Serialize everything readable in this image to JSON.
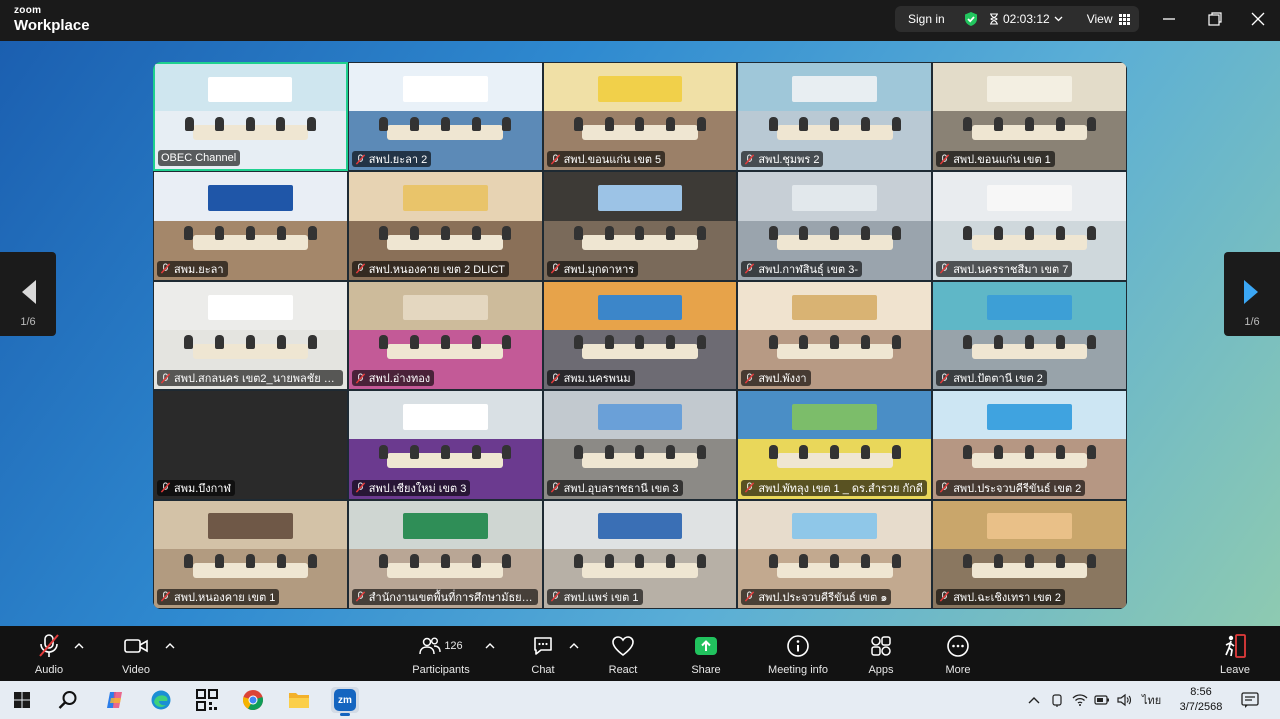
{
  "titlebar": {
    "logo_top": "zoom",
    "logo_bottom": "Workplace",
    "sign_in": "Sign in",
    "timer": "02:03:12",
    "view": "View"
  },
  "pager": {
    "left_page": "1/6",
    "right_page": "1/6"
  },
  "tiles": [
    {
      "name": "OBEC Channel",
      "muted": false,
      "wall": "#cfe6ef",
      "floor": "#e7eef4",
      "banner": "#ffffff"
    },
    {
      "name": "สพป.ยะลา 2",
      "muted": true,
      "wall": "#e9f1f8",
      "floor": "#5c8ab7",
      "banner": "#ffffff"
    },
    {
      "name": "สพป.ขอนแก่น เขต 5",
      "muted": true,
      "wall": "#f0e0a6",
      "floor": "#9b8068",
      "banner": "#f1d04a"
    },
    {
      "name": "สพป.ชุมพร 2",
      "muted": true,
      "wall": "#9fc7d9",
      "floor": "#b9c9d4",
      "banner": "#e8eef2"
    },
    {
      "name": "สพป.ขอนแก่น เขต 1",
      "muted": true,
      "wall": "#e3dcc9",
      "floor": "#8a8275",
      "banner": "#f3efe2"
    },
    {
      "name": "สพม.ยะลา",
      "muted": true,
      "wall": "#e9eef5",
      "floor": "#a4876a",
      "banner": "#1f56a8"
    },
    {
      "name": "สพป.หนองคาย เขต 2 DLICT",
      "muted": true,
      "wall": "#e7d3b3",
      "floor": "#8a7058",
      "banner": "#e9c46a"
    },
    {
      "name": "สพป.มุกดาหาร",
      "muted": true,
      "wall": "#3d3a36",
      "floor": "#7a6a5a",
      "banner": "#9cc3e6"
    },
    {
      "name": "สพป.กาฬสินธุ์ เขต 3-",
      "muted": true,
      "wall": "#c7cfd6",
      "floor": "#9aa4ad",
      "banner": "#e2e8ec"
    },
    {
      "name": "สพป.นครราชสีมา เขต 7",
      "muted": true,
      "wall": "#e9ecef",
      "floor": "#cfd8dc",
      "banner": "#f7f7f7"
    },
    {
      "name": "สพป.สกลนคร เขต2_นายพลชัย ชุม...",
      "muted": true,
      "wall": "#ececea",
      "floor": "#e4e4e0",
      "banner": "#ffffff"
    },
    {
      "name": "สพป.อ่างทอง",
      "muted": true,
      "wall": "#cdbb9b",
      "floor": "#c35a97",
      "banner": "#e4d7c0"
    },
    {
      "name": "สพม.นครพนม",
      "muted": true,
      "wall": "#e7a34a",
      "floor": "#6d6b73",
      "banner": "#3c86c9"
    },
    {
      "name": "สพป.พังงา",
      "muted": true,
      "wall": "#f0e3cf",
      "floor": "#b79a84",
      "banner": "#d9b373"
    },
    {
      "name": "สพป.ปัตตานี เขต 2",
      "muted": true,
      "wall": "#5fb7c7",
      "floor": "#98a3aa",
      "banner": "#3d9fd6"
    },
    {
      "name": "สพม.บึงกาฬ",
      "muted": true,
      "wall": "#262626",
      "floor": "#262626",
      "banner": "#262626"
    },
    {
      "name": "สพป.เชียงใหม่ เขต 3",
      "muted": true,
      "wall": "#d9e0e4",
      "floor": "#6b3a8f",
      "banner": "#ffffff"
    },
    {
      "name": "สพป.อุบลราชธานี เขต 3",
      "muted": true,
      "wall": "#c2c9cf",
      "floor": "#8c8a86",
      "banner": "#6aa0d8"
    },
    {
      "name": "สพป.พัทลุง เขต 1 _ ดร.สำรวย กักดี",
      "muted": true,
      "wall": "#4a8ec6",
      "floor": "#e9d75a",
      "banner": "#7cbd6a"
    },
    {
      "name": "สพป.ประจวบคีรีขันธ์ เขต 2",
      "muted": true,
      "wall": "#cde6f3",
      "floor": "#b69783",
      "banner": "#3fa3e0"
    },
    {
      "name": "สพป.หนองคาย เขต 1",
      "muted": true,
      "wall": "#d3c2a7",
      "floor": "#b29b80",
      "banner": "#6f5847"
    },
    {
      "name": "สำนักงานเขตพื้นที่การศึกษามัธยมศึ...",
      "muted": true,
      "wall": "#cfd6d2",
      "floor": "#b9a695",
      "banner": "#2f8e57"
    },
    {
      "name": "สพป.แพร่ เขต 1",
      "muted": true,
      "wall": "#dfe2e3",
      "floor": "#b7b0a6",
      "banner": "#3a6fb5"
    },
    {
      "name": "สพป.ประจวบคีรีขันธ์ เขต ๑",
      "muted": true,
      "wall": "#e7dccc",
      "floor": "#c2a98f",
      "banner": "#8fc7e8"
    },
    {
      "name": "สพป.ฉะเชิงเทรา เขต 2",
      "muted": true,
      "wall": "#c9a66b",
      "floor": "#8a7760",
      "banner": "#e9c088"
    }
  ],
  "toolbar": {
    "audio": "Audio",
    "video": "Video",
    "participants": "Participants",
    "participants_count": "126",
    "chat": "Chat",
    "react": "React",
    "share": "Share",
    "meeting_info": "Meeting info",
    "apps": "Apps",
    "more": "More",
    "leave": "Leave"
  },
  "taskbar": {
    "lang": "ไทย",
    "time": "8:56",
    "date": "3/7/2568",
    "zoom_label": "zm"
  },
  "colors": {
    "accent_green": "#1fd08f",
    "share_green": "#21c25e",
    "mute_red": "#e23b3b",
    "taskbar_accent": "#1565c0"
  }
}
